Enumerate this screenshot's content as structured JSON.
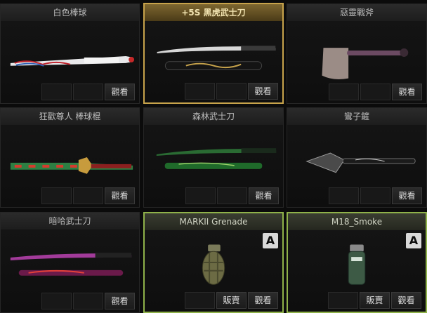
{
  "items": [
    {
      "title": "白色棒球",
      "action": "觀看"
    },
    {
      "title": "+5S 黑虎武士刀",
      "action": "觀看"
    },
    {
      "title": "惡靈戰斧",
      "action": "觀看"
    },
    {
      "title": "狂歡尊人 棒球棍",
      "action": "觀看"
    },
    {
      "title": "森林武士刀",
      "action": "觀看"
    },
    {
      "title": "鸞子鏟",
      "action": "觀看"
    },
    {
      "title": "暗哈武士刀",
      "action": "觀看"
    },
    {
      "title": "MARKII Grenade",
      "badge": "A",
      "sell": "販賣",
      "action": "觀看"
    },
    {
      "title": "M18_Smoke",
      "badge": "A",
      "sell": "販賣",
      "action": "觀看"
    }
  ]
}
